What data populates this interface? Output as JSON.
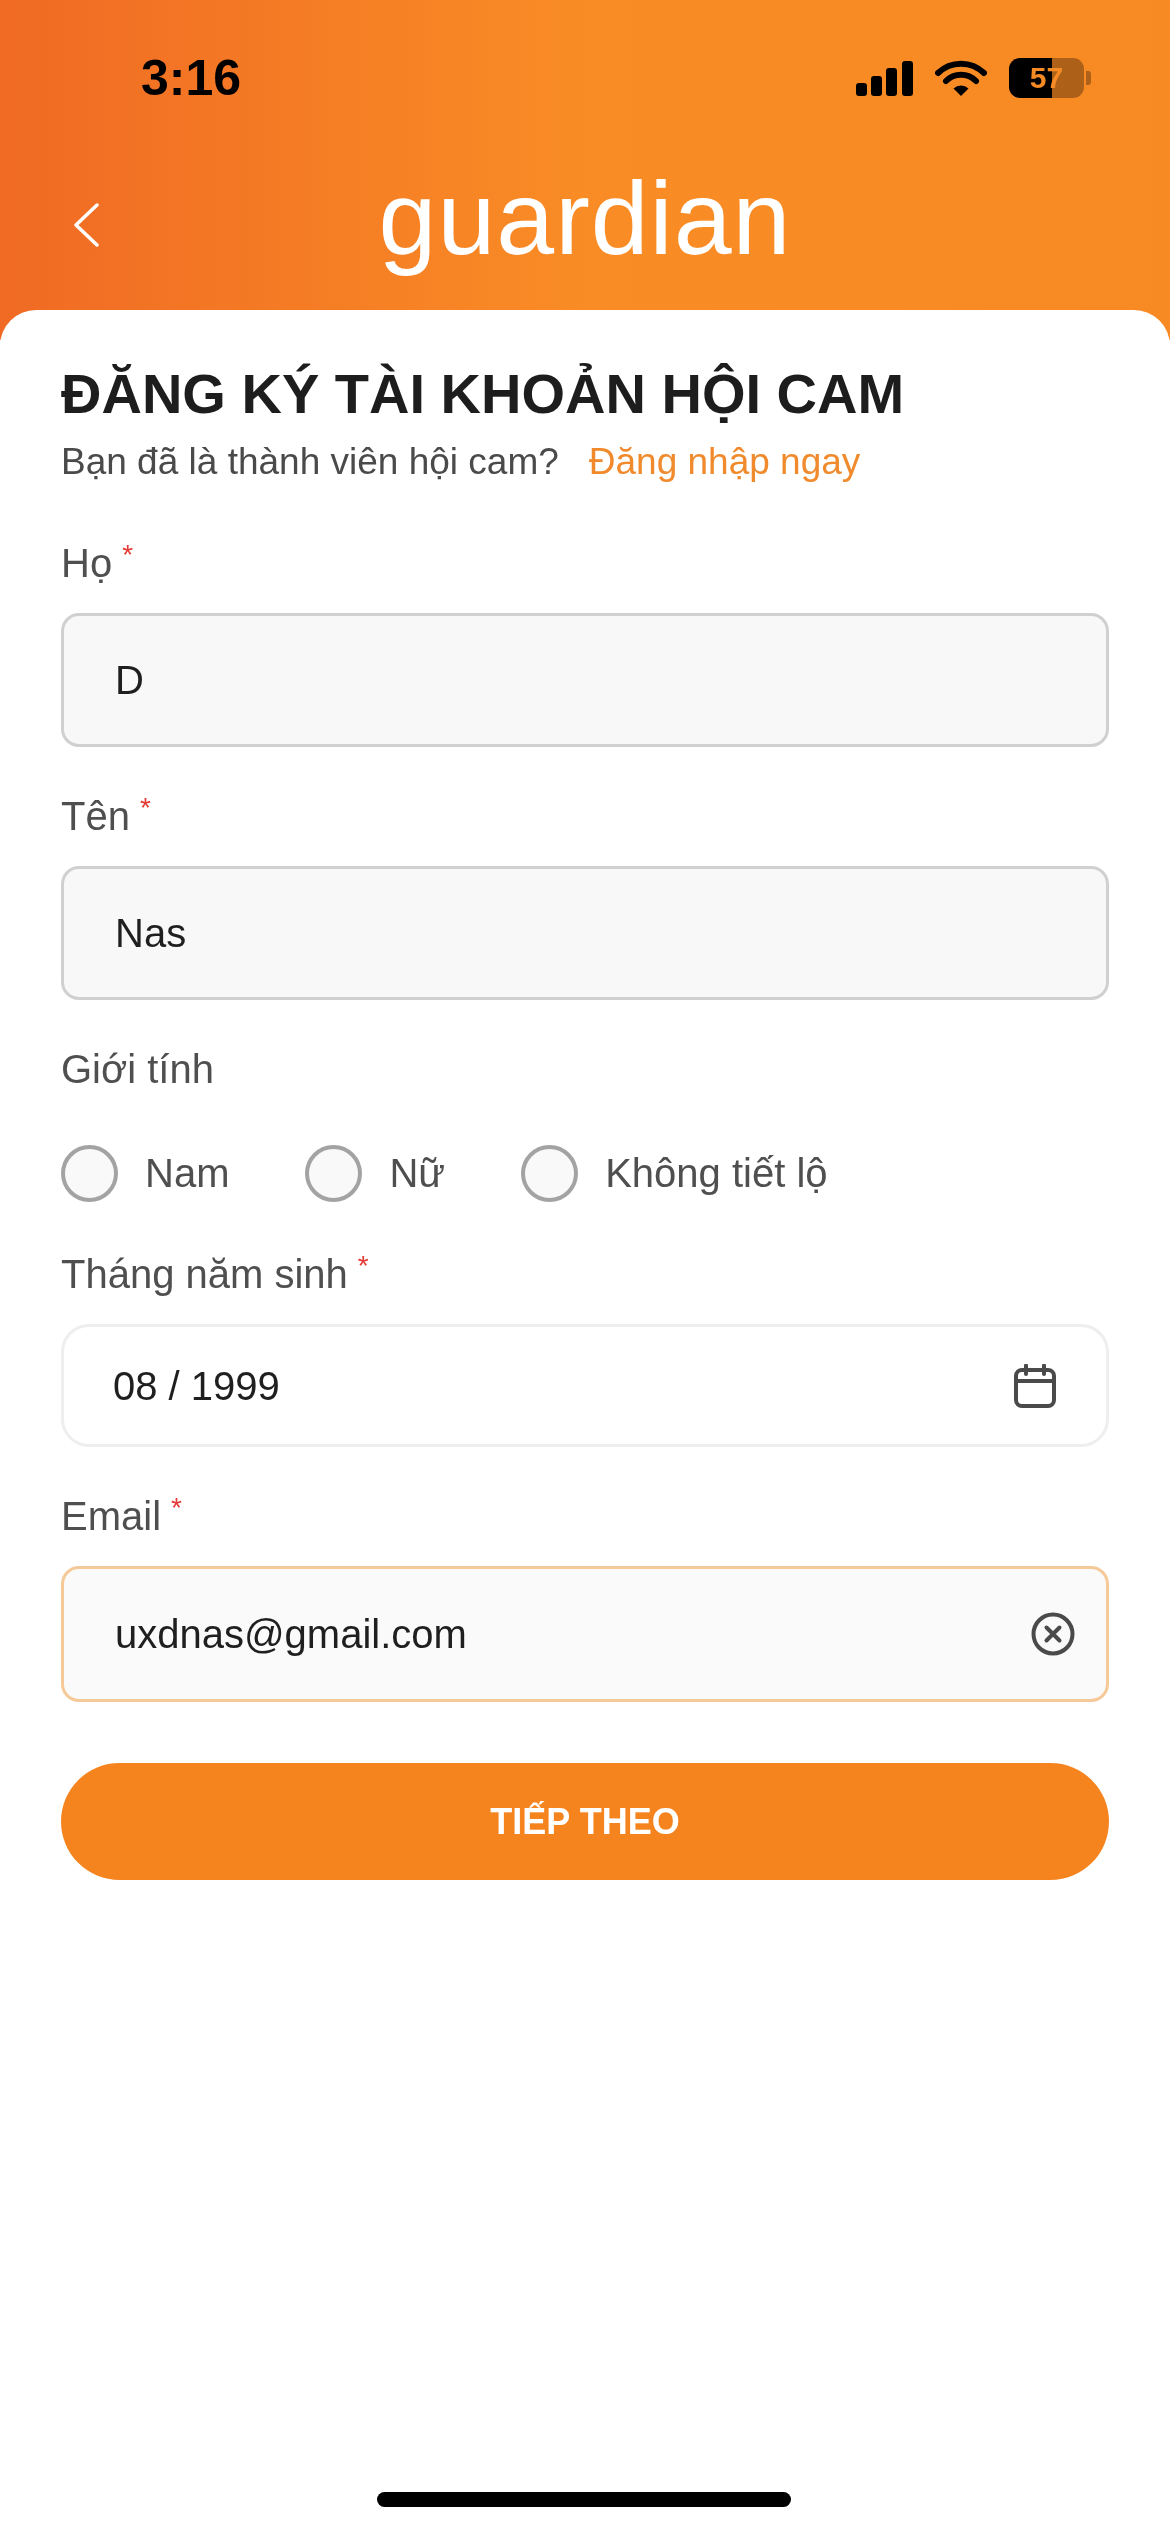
{
  "status_bar": {
    "time": "3:16",
    "battery": "57"
  },
  "header": {
    "logo": "guardian"
  },
  "title": "ĐĂNG KÝ TÀI KHOẢN HỘI CAM",
  "subtitle": {
    "text": "Bạn đã là thành viên hội cam?",
    "link": "Đăng nhập ngay"
  },
  "form": [
    {
      "kind": "text",
      "label": "Họ",
      "required_mark": "*",
      "value": "D",
      "focused": false
    },
    {
      "kind": "text",
      "label": "Tên",
      "required_mark": "*",
      "value": "Nas",
      "focused": false
    },
    {
      "kind": "radio",
      "label": "Giới tính",
      "options": [
        {
          "label": "Nam",
          "selected": false
        },
        {
          "label": "Nữ",
          "selected": false
        },
        {
          "label": "Không tiết lộ",
          "selected": false
        }
      ]
    },
    {
      "kind": "date",
      "label": "Tháng năm sinh",
      "required_mark": "*",
      "value": "08 / 1999",
      "focused": false
    },
    {
      "kind": "text",
      "label": "Email",
      "required_mark": "*",
      "value": "uxdnas@gmail.com",
      "focused": true
    }
  ],
  "submit_button": {
    "label": "TIẾP THEO"
  }
}
